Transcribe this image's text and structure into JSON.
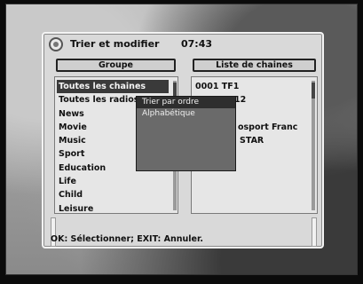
{
  "window": {
    "title": "Trier et modifier",
    "time": "07:43"
  },
  "group_panel": {
    "header": "Groupe",
    "items": [
      "Toutes les chaines",
      "Toutes les radios",
      "News",
      "Movie",
      "Music",
      "Sport",
      "Education",
      "Life",
      "Child",
      "Leisure"
    ],
    "selected_index": 0
  },
  "channel_panel": {
    "header": "Liste de chaines",
    "items": [
      "0001  TF1",
      "",
      "",
      "",
      "",
      ""
    ],
    "partial_fragments": [
      "12",
      "osport Franc",
      "STAR"
    ]
  },
  "popup": {
    "items": [
      "Trier par ordre",
      "Alphabétique"
    ],
    "selected_index": 0
  },
  "help": "OK: Sélectionner; EXIT: Annuler."
}
